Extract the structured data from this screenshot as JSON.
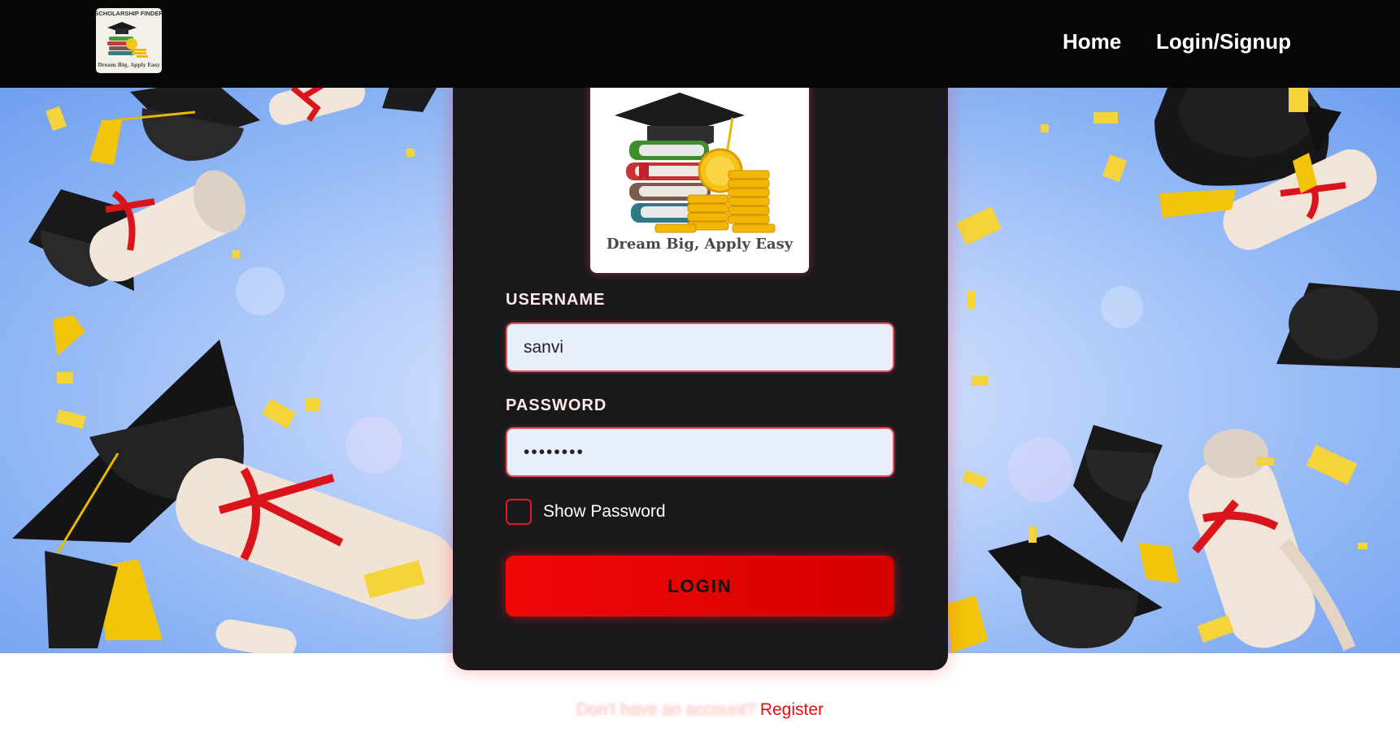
{
  "nav": {
    "logo_top_text": "SCHOLARSHIP FINDER",
    "logo_tagline": "Dream Big, Apply Easy",
    "links": [
      {
        "label": "Home"
      },
      {
        "label": "Login/Signup"
      }
    ]
  },
  "card": {
    "logo_tagline": "Dream Big, Apply Easy",
    "username_label": "USERNAME",
    "username_value": "sanvi",
    "password_label": "PASSWORD",
    "password_value": "••••••••",
    "show_password_label": "Show Password",
    "show_password_checked": false,
    "login_button": "LOGIN"
  },
  "footer": {
    "question": "Don't have an account?",
    "register_link": "Register"
  },
  "colors": {
    "accent": "#e80d0d",
    "navbar_bg": "#060606",
    "card_bg": "#19191c",
    "input_bg": "#e8eefc"
  },
  "icons": [
    "graduation-cap-icon",
    "books-icon",
    "coins-icon",
    "diploma-scroll-icon",
    "confetti"
  ]
}
